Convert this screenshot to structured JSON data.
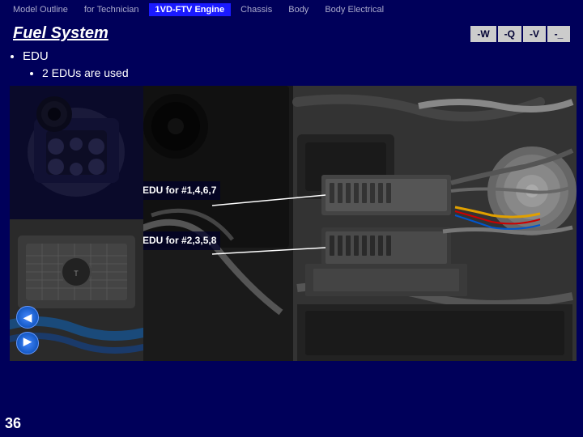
{
  "nav": {
    "items": [
      {
        "label": "Model Outline",
        "active": false
      },
      {
        "label": "for Technician",
        "active": false
      },
      {
        "label": "1VD-FTV Engine",
        "active": true
      },
      {
        "label": "Chassis",
        "active": false
      },
      {
        "label": "Body",
        "active": false
      },
      {
        "label": "Body Electrical",
        "active": false
      }
    ]
  },
  "title": "Fuel System",
  "toolbar": {
    "buttons": [
      "-W",
      "-Q",
      "-V",
      "-_"
    ]
  },
  "bullets": {
    "main": "EDU",
    "sub": "2 EDUs are used"
  },
  "image_labels": {
    "label1": "EDU for\n#1,4,6,7",
    "label2": "EDU for\n#2,3,5,8"
  },
  "page_number": "36",
  "nav_arrows": {
    "up": "◀",
    "down": "◀"
  }
}
